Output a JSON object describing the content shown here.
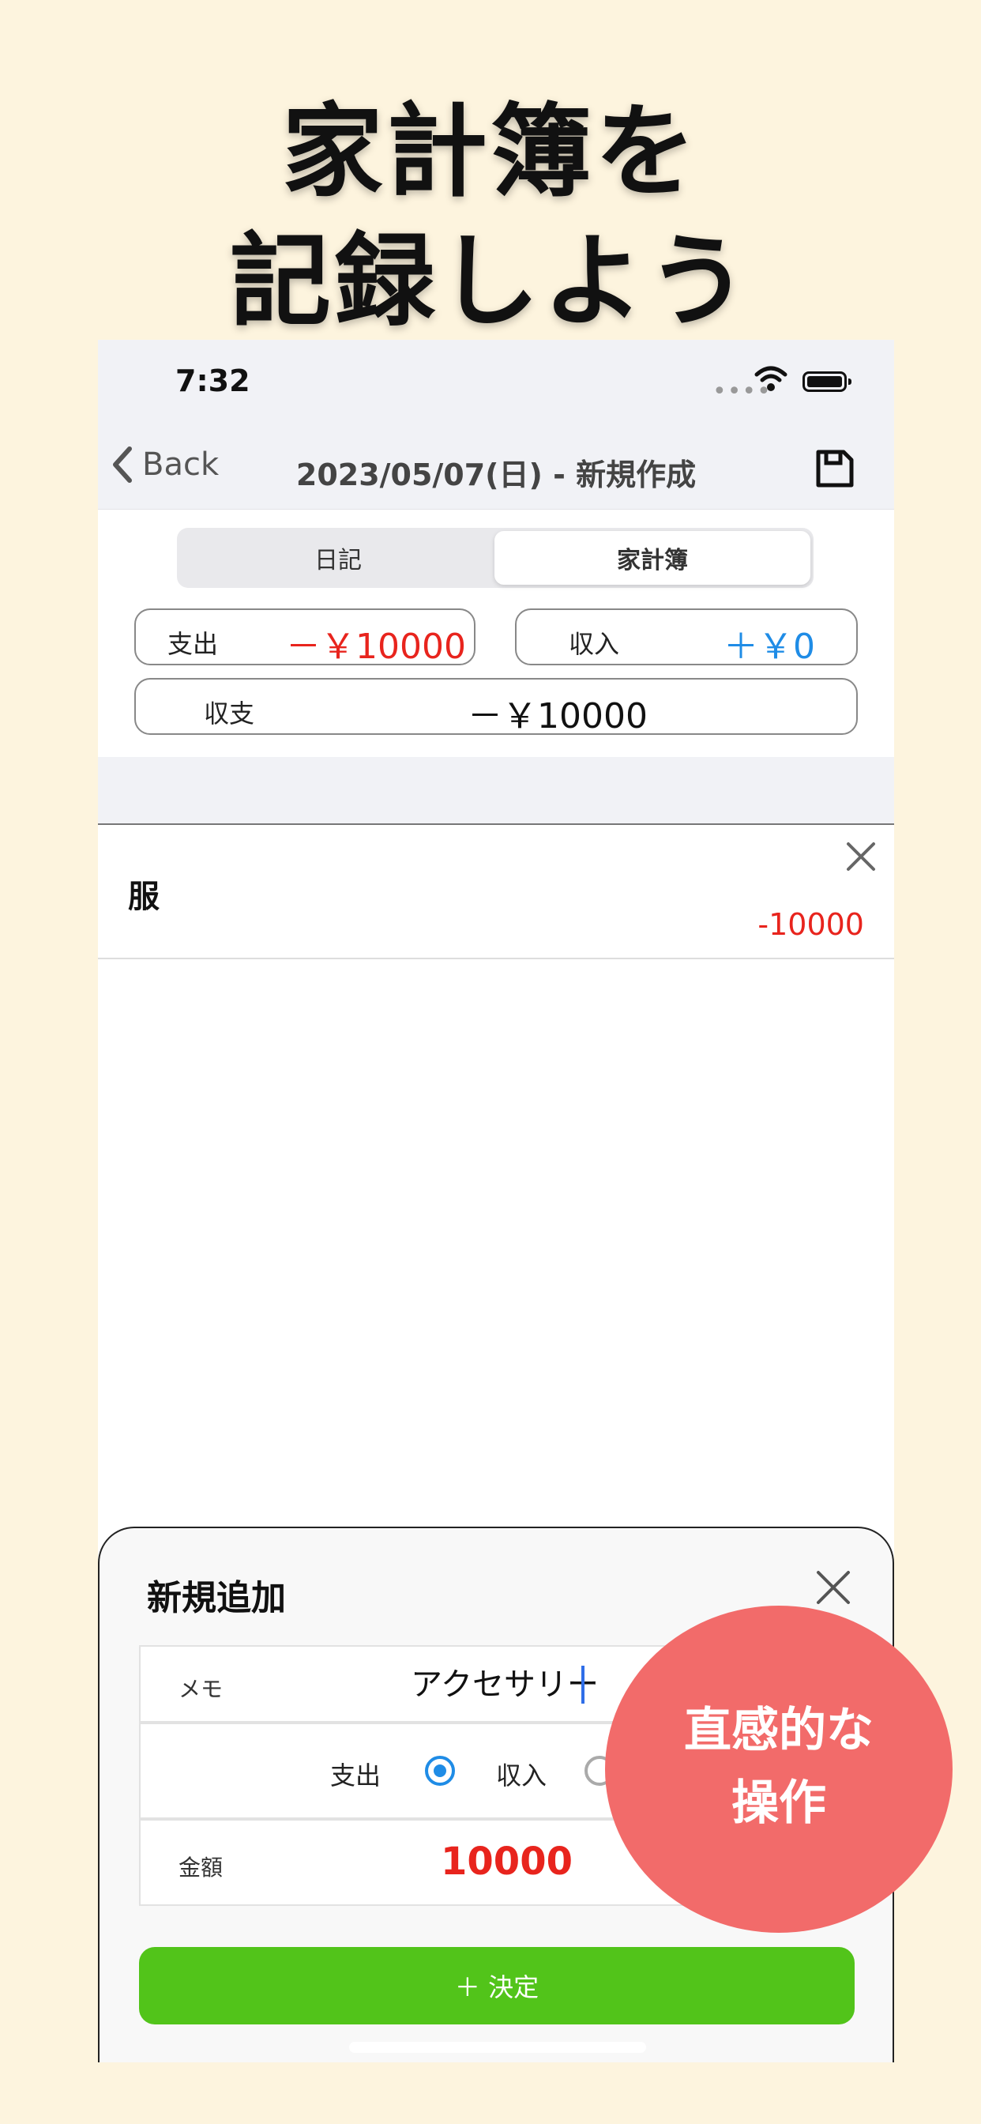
{
  "headline": {
    "line1": "家計簿を",
    "line2": "記録しよう"
  },
  "status_bar": {
    "time": "7:32",
    "signal": "••••"
  },
  "nav": {
    "back_label": "Back",
    "title": "2023/05/07(日) - 新規作成"
  },
  "segments": {
    "diary": "日記",
    "household": "家計簿",
    "selected": "家計簿"
  },
  "summary": {
    "expense_label": "支出",
    "expense_value": "－￥10000",
    "income_label": "収入",
    "income_value": "＋￥0",
    "balance_label": "収支",
    "balance_value": "－￥10000"
  },
  "entries": [
    {
      "name": "服",
      "amount": "-10000"
    }
  ],
  "sheet": {
    "title": "新規追加",
    "memo_label": "メモ",
    "memo_value": "アクセサリー",
    "type_expense": "支出",
    "type_income": "収入",
    "type_selected": "支出",
    "amount_label": "金額",
    "amount_value": "10000",
    "confirm_label": "＋ 決定"
  },
  "badge": {
    "line1": "直感的な",
    "line2": "操作"
  },
  "colors": {
    "background": "#fdf4de",
    "expense": "#e8241d",
    "income": "#1f8ce6",
    "confirm": "#52c41a",
    "badge": "#f26b6a"
  },
  "icons": [
    "chevron-left-icon",
    "save-icon",
    "wifi-icon",
    "battery-icon",
    "close-icon"
  ]
}
